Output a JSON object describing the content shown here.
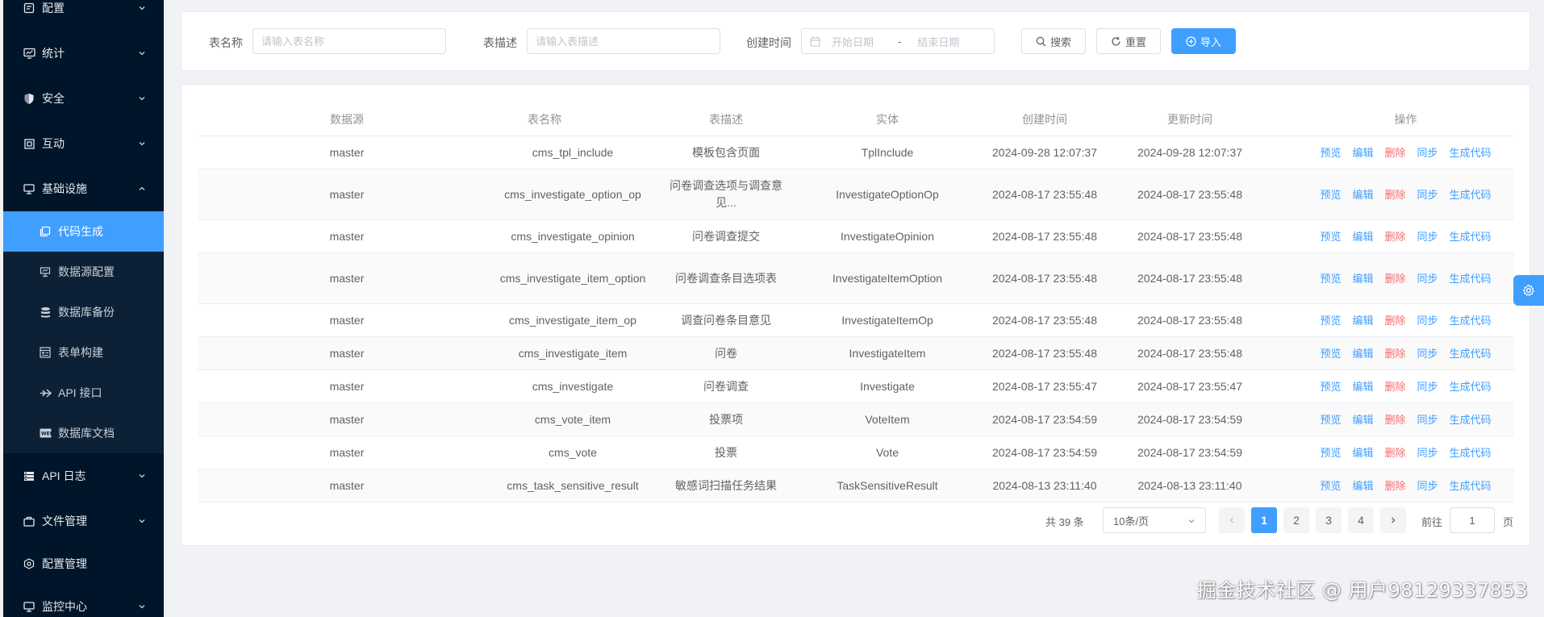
{
  "sidebar": {
    "items": [
      {
        "label": "配置",
        "icon": "settings-doc-icon"
      },
      {
        "label": "统计",
        "icon": "chart-icon"
      },
      {
        "label": "安全",
        "icon": "shield-icon"
      },
      {
        "label": "互动",
        "icon": "interact-icon"
      },
      {
        "label": "基础设施",
        "icon": "monitor-icon"
      }
    ],
    "sub_items": [
      {
        "label": "代码生成",
        "icon": "code-gen-icon"
      },
      {
        "label": "数据源配置",
        "icon": "datasource-icon"
      },
      {
        "label": "数据库备份",
        "icon": "database-icon"
      },
      {
        "label": "表单构建",
        "icon": "form-icon"
      },
      {
        "label": "API 接口",
        "icon": "api-icon"
      },
      {
        "label": "数据库文档",
        "icon": "doc-icon"
      }
    ],
    "bottom_items": [
      {
        "label": "API 日志",
        "icon": "log-icon"
      },
      {
        "label": "文件管理",
        "icon": "folder-icon"
      },
      {
        "label": "配置管理",
        "icon": "config-icon"
      },
      {
        "label": "监控中心",
        "icon": "monitor-center-icon"
      }
    ]
  },
  "search": {
    "table_name_label": "表名称",
    "table_name_placeholder": "请输入表名称",
    "table_desc_label": "表描述",
    "table_desc_placeholder": "请输入表描述",
    "create_time_label": "创建时间",
    "start_date_placeholder": "开始日期",
    "range_separator": "-",
    "end_date_placeholder": "结束日期",
    "search_label": "搜索",
    "reset_label": "重置",
    "import_label": "导入"
  },
  "table": {
    "columns": [
      "数据源",
      "表名称",
      "表描述",
      "实体",
      "创建时间",
      "更新时间",
      "操作"
    ],
    "ops": [
      "预览",
      "编辑",
      "删除",
      "同步",
      "生成代码"
    ],
    "rows": [
      {
        "source": "master",
        "name": "cms_tpl_include",
        "desc": "模板包含页面",
        "entity": "TplInclude",
        "created": "2024-09-28 12:07:37",
        "updated": "2024-09-28 12:07:37"
      },
      {
        "source": "master",
        "name": "cms_investigate_option_op",
        "desc": "问卷调查选项与调查意见...",
        "entity": "InvestigateOptionOp",
        "created": "2024-08-17 23:55:48",
        "updated": "2024-08-17 23:55:48"
      },
      {
        "source": "master",
        "name": "cms_investigate_opinion",
        "desc": "问卷调查提交",
        "entity": "InvestigateOpinion",
        "created": "2024-08-17 23:55:48",
        "updated": "2024-08-17 23:55:48"
      },
      {
        "source": "master",
        "name": "cms_investigate_item_option",
        "desc": "问卷调查条目选项表",
        "entity": "InvestigateItemOption",
        "created": "2024-08-17 23:55:48",
        "updated": "2024-08-17 23:55:48"
      },
      {
        "source": "master",
        "name": "cms_investigate_item_op",
        "desc": "调查问卷条目意见",
        "entity": "InvestigateItemOp",
        "created": "2024-08-17 23:55:48",
        "updated": "2024-08-17 23:55:48"
      },
      {
        "source": "master",
        "name": "cms_investigate_item",
        "desc": "问卷",
        "entity": "InvestigateItem",
        "created": "2024-08-17 23:55:48",
        "updated": "2024-08-17 23:55:48"
      },
      {
        "source": "master",
        "name": "cms_investigate",
        "desc": "问卷调查",
        "entity": "Investigate",
        "created": "2024-08-17 23:55:47",
        "updated": "2024-08-17 23:55:47"
      },
      {
        "source": "master",
        "name": "cms_vote_item",
        "desc": "投票项",
        "entity": "VoteItem",
        "created": "2024-08-17 23:54:59",
        "updated": "2024-08-17 23:54:59"
      },
      {
        "source": "master",
        "name": "cms_vote",
        "desc": "投票",
        "entity": "Vote",
        "created": "2024-08-17 23:54:59",
        "updated": "2024-08-17 23:54:59"
      },
      {
        "source": "master",
        "name": "cms_task_sensitive_result",
        "desc": "敏感词扫描任务结果",
        "entity": "TaskSensitiveResult",
        "created": "2024-08-13 23:11:40",
        "updated": "2024-08-13 23:11:40"
      }
    ]
  },
  "pagination": {
    "total_text": "共 39 条",
    "page_size": "10条/页",
    "pages": [
      "1",
      "2",
      "3",
      "4"
    ],
    "current_page": 1,
    "goto_label": "前往",
    "goto_value": "1",
    "page_unit": "页"
  },
  "watermark": "掘金技术社区 @ 用户98129337853",
  "colors": {
    "sidebar_bg": "#001529",
    "accent": "#409eff",
    "danger": "#f56c6c"
  }
}
